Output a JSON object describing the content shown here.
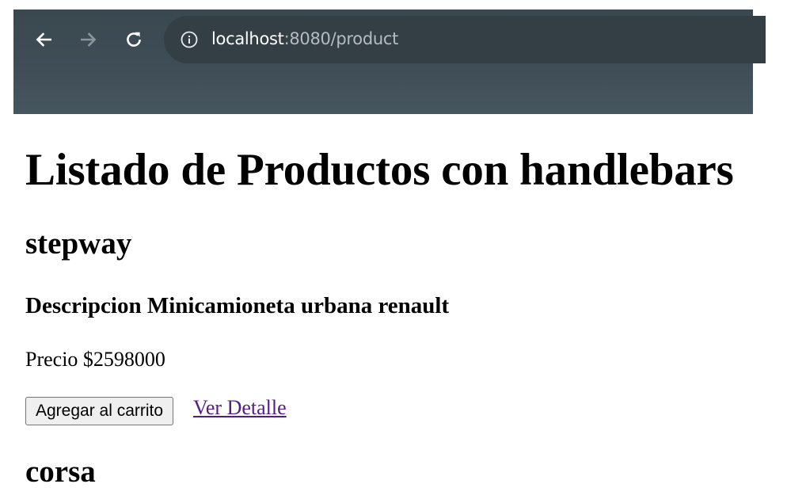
{
  "browser": {
    "url_host": "localhost",
    "url_rest": ":8080/product",
    "icons": {
      "back": "arrow-left-icon",
      "forward": "arrow-right-icon",
      "reload": "reload-icon",
      "info": "info-icon"
    },
    "colors": {
      "toolbar": "#3e4c55",
      "omnibox": "#343f45"
    }
  },
  "page": {
    "title": "Listado de Productos con handlebars",
    "products": [
      {
        "name": "stepway",
        "description": "Descripcion Minicamioneta urbana renault",
        "price": "Precio $2598000",
        "add_to_cart_label": "Agregar al carrito",
        "detail_link_label": "Ver Detalle"
      },
      {
        "name": "corsa"
      }
    ],
    "colors": {
      "visited_link": "#551a8b"
    }
  }
}
